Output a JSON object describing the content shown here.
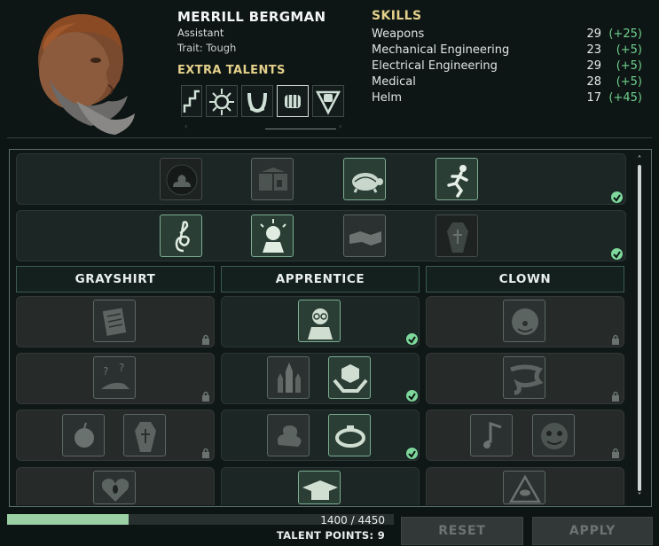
{
  "character": {
    "name": "MERRILL BERGMAN",
    "role": "Assistant",
    "trait": "Trait: Tough"
  },
  "extra_talents": {
    "title": "EXTRA TALENTS",
    "icons": [
      "stairs-icon",
      "gear-sun-icon",
      "horseshoe-icon",
      "fist-icon",
      "shield-fist-icon"
    ],
    "scroll_left": "‹",
    "scroll_right": "›"
  },
  "skills": {
    "title": "SKILLS",
    "rows": [
      {
        "name": "Weapons",
        "value": "29",
        "bonus": "(+25)"
      },
      {
        "name": "Mechanical Engineering",
        "value": "23",
        "bonus": "(+5)"
      },
      {
        "name": "Electrical Engineering",
        "value": "29",
        "bonus": "(+5)"
      },
      {
        "name": "Medical",
        "value": "28",
        "bonus": "(+5)"
      },
      {
        "name": "Helm",
        "value": "17",
        "bonus": "(+45)"
      }
    ]
  },
  "tree": {
    "row1_icons": [
      "poop-icon",
      "crate-icon",
      "turtle-icon",
      "running-man-icon"
    ],
    "row2_icons": [
      "treble-clef-icon",
      "cheering-man-icon",
      "handshake-icon",
      "coffin-icon"
    ],
    "columns": [
      {
        "header": "GRAYSHIRT"
      },
      {
        "header": "APPRENTICE"
      },
      {
        "header": "CLOWN"
      }
    ],
    "grayshirt_icons": [
      "documents-icon",
      "question-cat-icon",
      "apple-icon",
      "coffin-icon",
      "scream-icon"
    ],
    "apprentice_icons": [
      "scientist-icon",
      "rockets-icon",
      "hands-box-icon",
      "smoke-icon",
      "ring-icon",
      "graduation-cap-icon"
    ],
    "clown_icons": [
      "clown-face-icon",
      "slime-icon",
      "note-icon",
      "clown-mask-icon",
      "eye-pyramid-icon"
    ]
  },
  "progress": {
    "current": 1400,
    "max": 4450,
    "text": "1400 / 4450",
    "fraction": 0.315,
    "talent_points": "TALENT POINTS: 9"
  },
  "buttons": {
    "reset": "RESET",
    "apply": "APPLY"
  },
  "scroll": {
    "up": "˄",
    "down": "˅"
  }
}
